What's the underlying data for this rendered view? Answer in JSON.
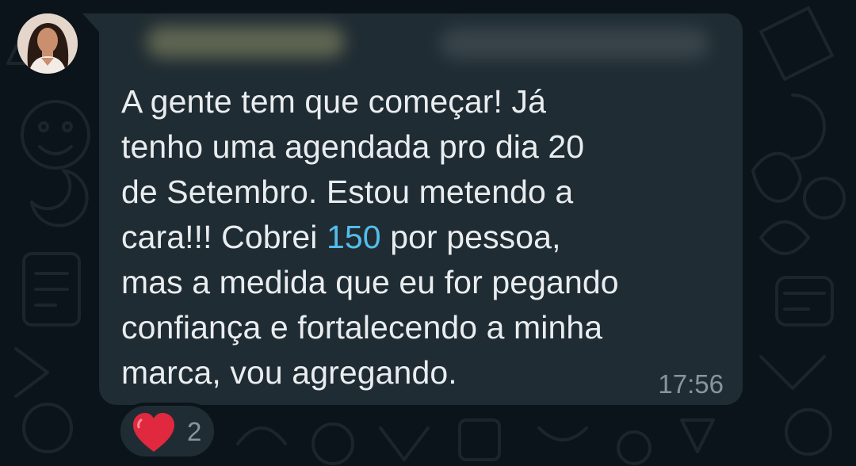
{
  "message": {
    "sender_name": "",
    "sender_phone": "",
    "text_before": "A gente tem que começar! Já\ntenho uma agendada pro dia 20\nde Setembro. Estou metendo a\ncara!!! Cobrei ",
    "highlight_number": "150",
    "text_after": " por pessoa,\nmas a medida que eu for pegando\nconfiança e fortalecendo a minha\nmarca, vou agregando.",
    "time": "17:56"
  },
  "reaction": {
    "emoji_icon": "red-heart-icon",
    "count": "2"
  },
  "colors": {
    "background": "#0b141a",
    "bubble": "#202c33",
    "text": "#e9edef",
    "link_number": "#53bdeb",
    "meta": "#8696a0",
    "heart": "#e0283f"
  }
}
